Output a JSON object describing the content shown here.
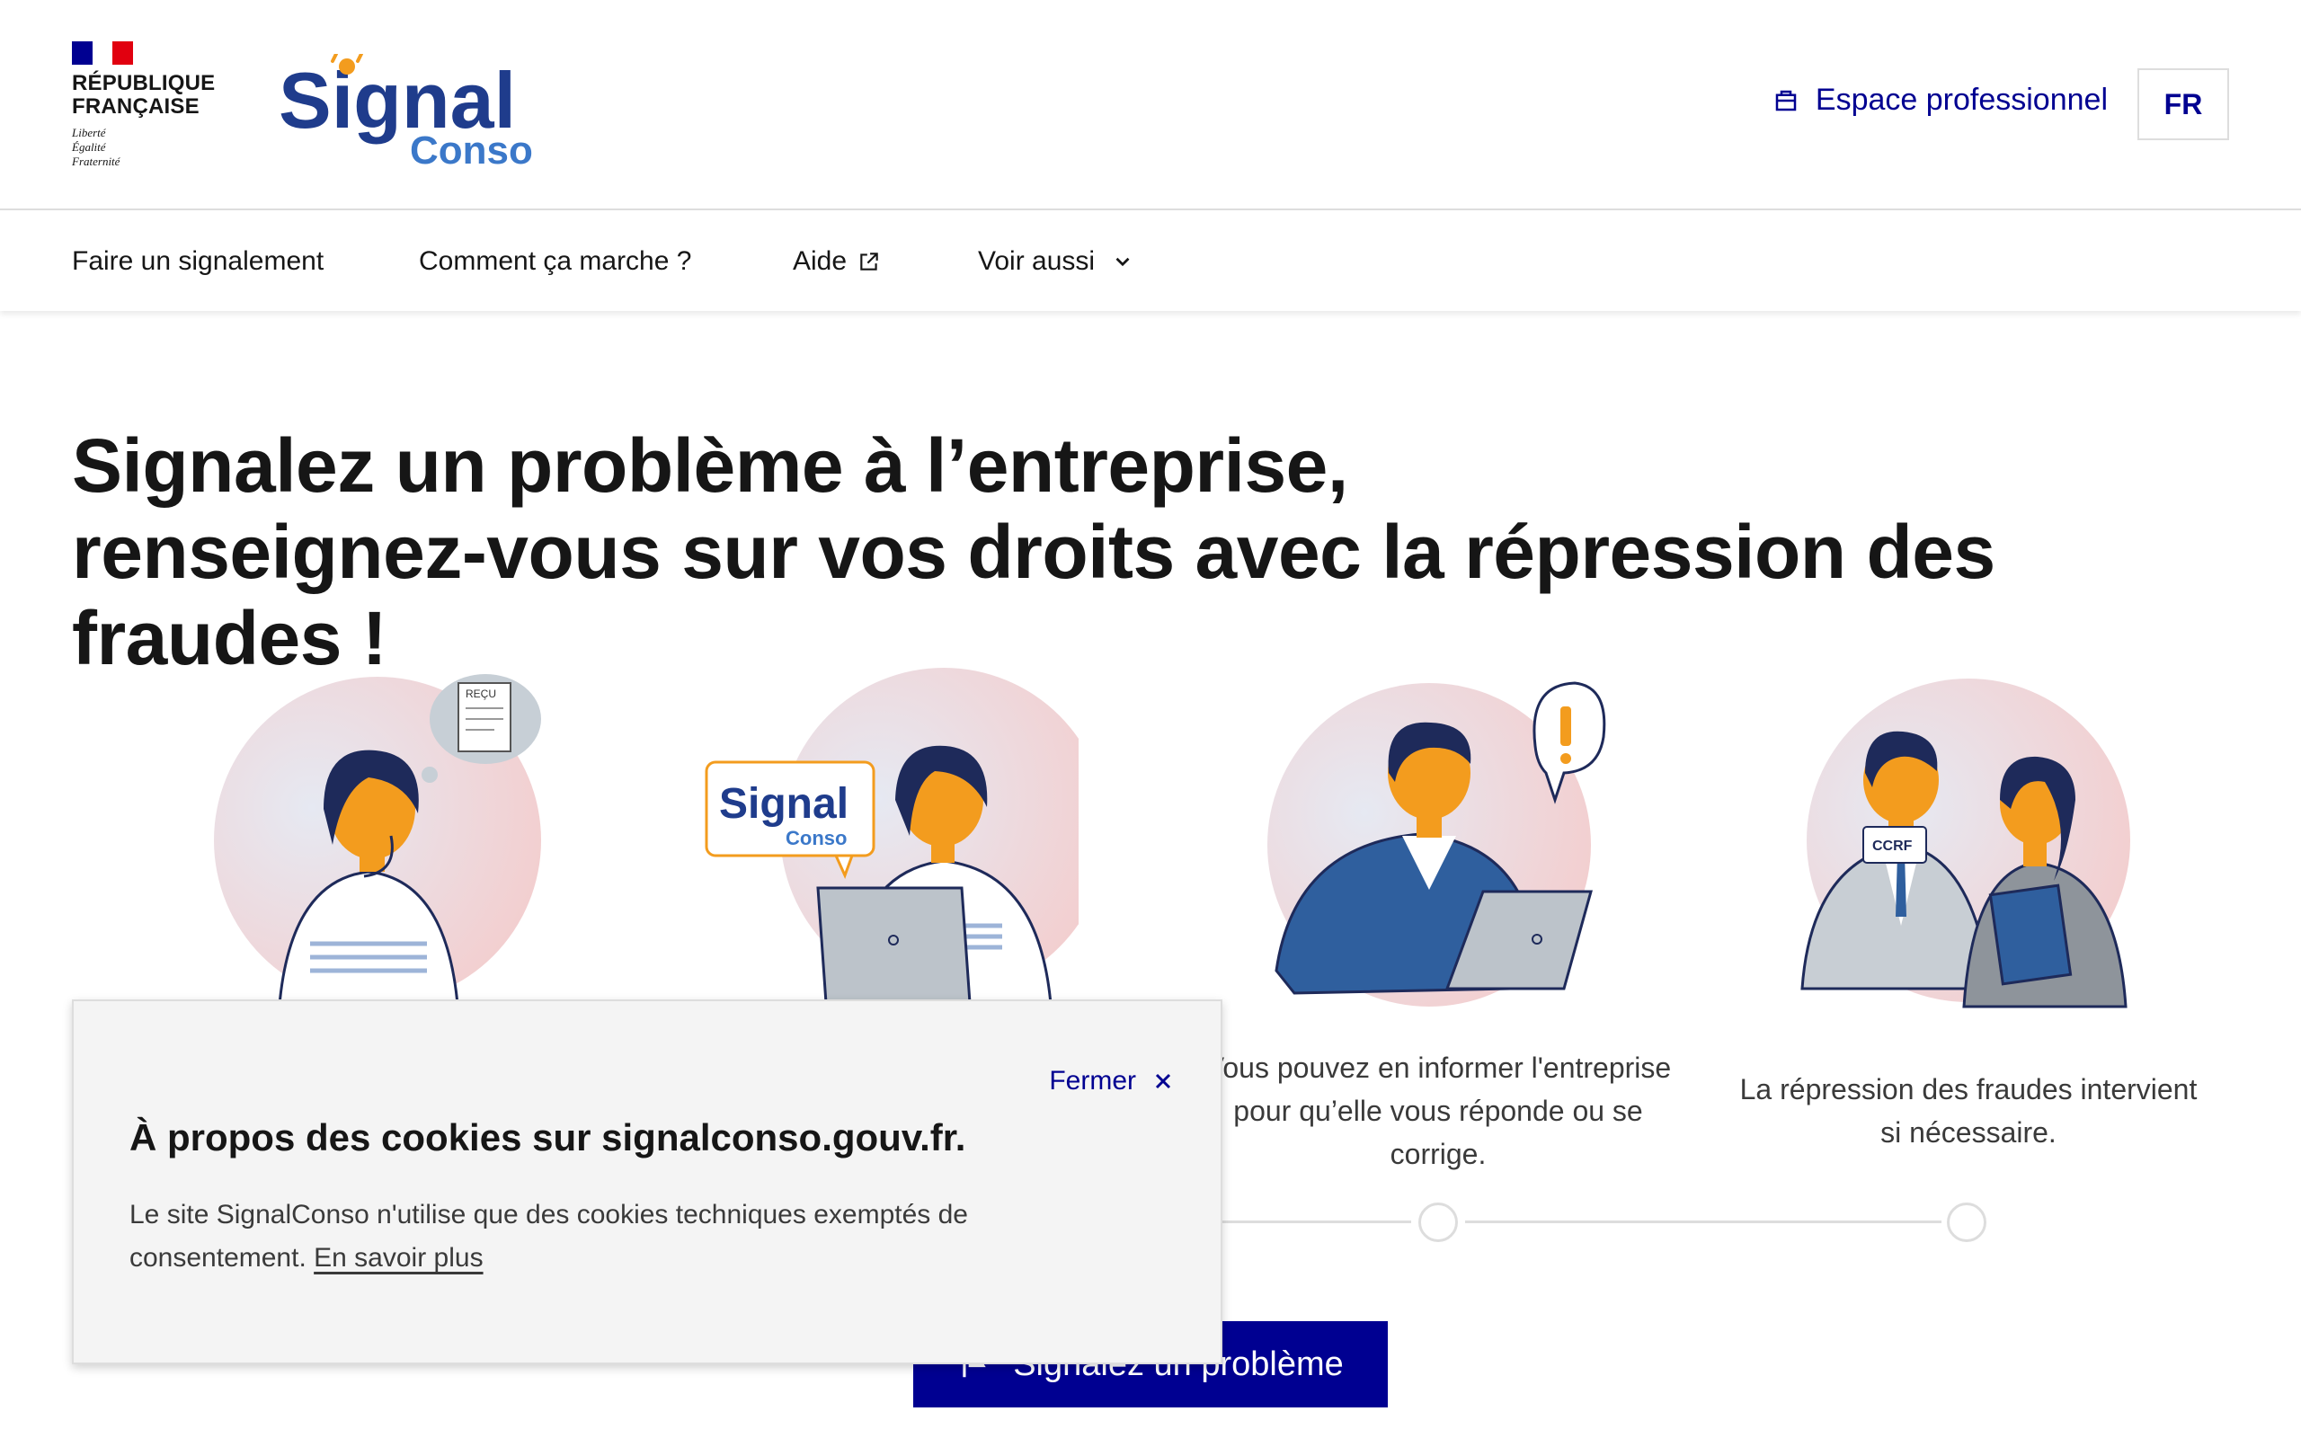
{
  "header": {
    "gov_name_line1": "RÉPUBLIQUE",
    "gov_name_line2": "FRANÇAISE",
    "motto1": "Liberté",
    "motto2": "Égalité",
    "motto3": "Fraternité",
    "brand_main": "Signal",
    "brand_sub": "Conso",
    "espace_pro_label": "Espace professionnel",
    "lang_label": "FR"
  },
  "nav": {
    "items": [
      {
        "label": "Faire un signalement"
      },
      {
        "label": "Comment ça marche ?"
      },
      {
        "label": "Aide"
      },
      {
        "label": "Voir aussi"
      }
    ]
  },
  "hero": {
    "title_line1": "Signalez un problème à l’entreprise,",
    "title_line2": "renseignez-vous sur vos droits avec la répression des fraudes !"
  },
  "steps": [
    {
      "text": ""
    },
    {
      "text": ""
    },
    {
      "text_line1": "Vous pouvez en informer l'entreprise",
      "text_line2": "pour qu’elle vous réponde ou se",
      "text_line3": "corrige."
    },
    {
      "text_line1": "La répression des fraudes intervient",
      "text_line2": "si nécessaire."
    }
  ],
  "illustrations": {
    "receipt_label": "REÇU",
    "badge_label": "CCRF"
  },
  "cta": {
    "label": "Signalez un problème"
  },
  "cookie": {
    "close_label": "Fermer",
    "title": "À propos des cookies sur signalconso.gouv.fr.",
    "text": "Le site SignalConso n'utilise que des cookies techniques exemptés de consentement.",
    "link_label": "En savoir plus"
  },
  "colors": {
    "primary": "#000091",
    "brand_blue": "#1f3c8c",
    "brand_light": "#3b78c9",
    "brand_orange": "#f39c1e",
    "flag_red": "#e1000f"
  }
}
